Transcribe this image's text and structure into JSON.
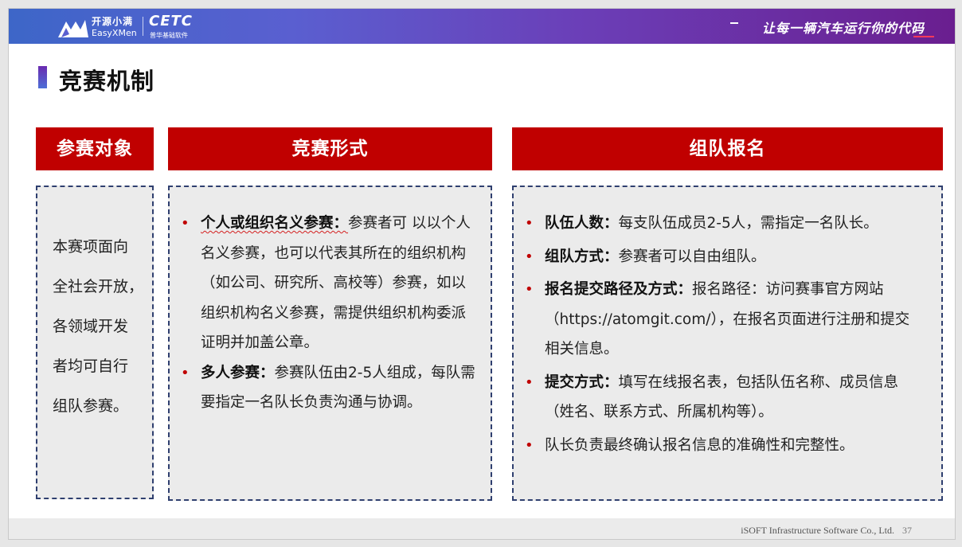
{
  "banner": {
    "logo_cn": "开源小满",
    "logo_en": "EasyXMen",
    "cetc": "CETC",
    "cetc_sub": "普华基础软件",
    "slogan": "让每一辆汽车运行你的代码",
    "colors": {
      "start": "#3d66c8",
      "end": "#6a1e8f"
    }
  },
  "title": "竞赛机制",
  "columns": {
    "participants": {
      "header": "参赛对象",
      "lines": [
        "本赛项面向",
        "全社会开放，",
        "各领域开发",
        "者均可自行",
        "组队参赛。"
      ]
    },
    "format": {
      "header": "竞赛形式",
      "items": [
        {
          "keyword": "个人或组织名义参赛：",
          "text": "参赛者可 以以个人名义参赛，也可以代表其所在的组织机构（如公司、研究所、高校等）参赛，如以组织机构名义参赛，需提供组织机构委派证明并加盖公章。"
        },
        {
          "keyword": "多人参赛：",
          "text": "参赛队伍由2-5人组成，每队需要指定一名队长负责沟通与协调。"
        }
      ]
    },
    "team": {
      "header": "组队报名",
      "items": [
        {
          "keyword": "队伍人数：",
          "text": "每支队伍成员2-5人，需指定一名队长。"
        },
        {
          "keyword": "组队方式：",
          "text": "参赛者可以自由组队。"
        },
        {
          "keyword": "报名提交路径及方式：",
          "text": "报名路径：访问赛事官方网站（https://atomgit.com/），在报名页面进行注册和提交相关信息。"
        },
        {
          "keyword": "提交方式：",
          "text": "填写在线报名表，包括队伍名称、成员信息（姓名、联系方式、所属机构等）。"
        },
        {
          "keyword": "",
          "text": "队长负责最终确认报名信息的准确性和完整性。"
        }
      ]
    }
  },
  "footer": {
    "company": "iSOFT Infrastructure Software Co., Ltd.",
    "page": "37"
  },
  "colors": {
    "accent_red": "#c00000",
    "box_bg": "#ebebeb",
    "border": "#2f3f6f"
  }
}
